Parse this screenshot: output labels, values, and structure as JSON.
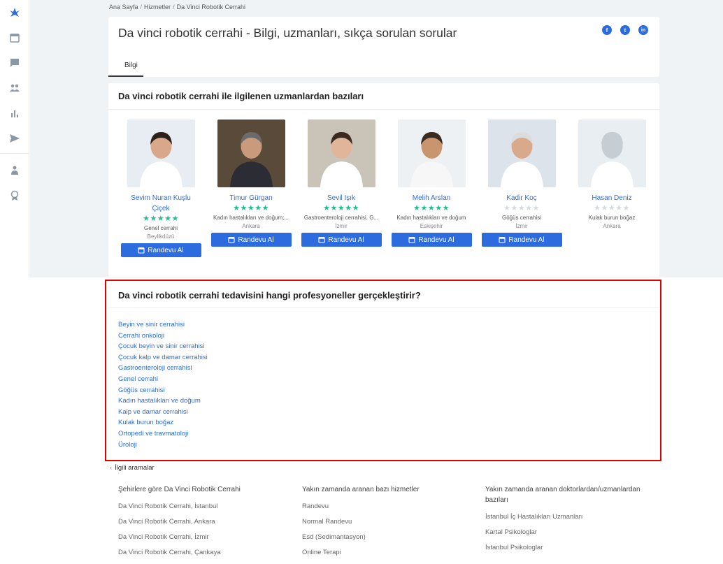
{
  "breadcrumb": [
    "Ana Sayfa",
    "Hizmetler",
    "Da Vinci Robotik Cerrahi"
  ],
  "page_title": "Da vinci robotik cerrahi - Bilgi, uzmanları, sıkça sorulan sorular",
  "social": {
    "facebook": "f",
    "twitter": "t",
    "linkedin": "in"
  },
  "tabs": [
    "Bilgi"
  ],
  "specialists_heading": "Da vinci robotik cerrahi ile ilgilenen uzmanlardan bazıları",
  "book_label": "Randevu Al",
  "doctors": [
    {
      "name": "Sevim Nuran Kuşlu Çiçek",
      "rating": 5,
      "specialty": "Genel cerrahi",
      "city": "Beylikdüzü",
      "has_button": true
    },
    {
      "name": "Timur Gürgan",
      "rating": 5,
      "specialty": "Kadın hastalıkları ve doğum;...",
      "city": "Ankara",
      "has_button": true
    },
    {
      "name": "Sevil Işık",
      "rating": 5,
      "specialty": "Gastroenteroloji cerrahisi, G...",
      "city": "İzmir",
      "has_button": true
    },
    {
      "name": "Melih Arslan",
      "rating": 5,
      "specialty": "Kadın hastalıkları ve doğum",
      "city": "Eskişehir",
      "has_button": true
    },
    {
      "name": "Kadir Koç",
      "rating": 0,
      "specialty": "Göğüs cerrahisi",
      "city": "İzmir",
      "has_button": true
    },
    {
      "name": "Hasan Deniz",
      "rating": 0,
      "specialty": "Kulak burun boğaz",
      "city": "Ankara",
      "has_button": false
    }
  ],
  "professionals_heading": "Da vinci robotik cerrahi tedavisini hangi profesyoneller gerçekleştirir?",
  "specialties": [
    "Beyin ve sinir cerrahisi",
    "Cerrahi onkoloji",
    "Çocuk beyin ve sinir cerrahisi",
    "Çocuk kalp ve damar cerrahisi",
    "Gastroenteroloji cerrahisi",
    "Genel cerrahi",
    "Göğüs cerrahisi",
    "Kadın hastalıkları ve doğum",
    "Kalp ve damar cerrahisi",
    "Kulak burun boğaz",
    "Ortopedi ve travmatoloji",
    "Üroloji"
  ],
  "related": {
    "heading": "İlgili aramalar",
    "columns": [
      {
        "title": "Şehirlere göre Da Vinci Robotik Cerrahi",
        "links": [
          "Da Vinci Robotik Cerrahi, İstanbul",
          "Da Vinci Robotik Cerrahi, Ankara",
          "Da Vinci Robotik Cerrahi, İzmir",
          "Da Vinci Robotik Cerrahi, Çankaya"
        ]
      },
      {
        "title": "Yakın zamanda aranan bazı hizmetler",
        "links": [
          "Randevu",
          "Normal Randevu",
          "Esd (Sedimantasyon)",
          "Online Terapi"
        ]
      },
      {
        "title": "Yakın zamanda aranan doktorlardan/uzmanlardan bazıları",
        "links": [
          "İstanbul İç Hastalıkları Uzmanları",
          "Kartal Psikologlar",
          "İstanbul Psikologlar"
        ]
      }
    ]
  },
  "colors": {
    "accent": "#2d6cde",
    "star": "#1dbf8e",
    "highlight": "#e00000"
  }
}
